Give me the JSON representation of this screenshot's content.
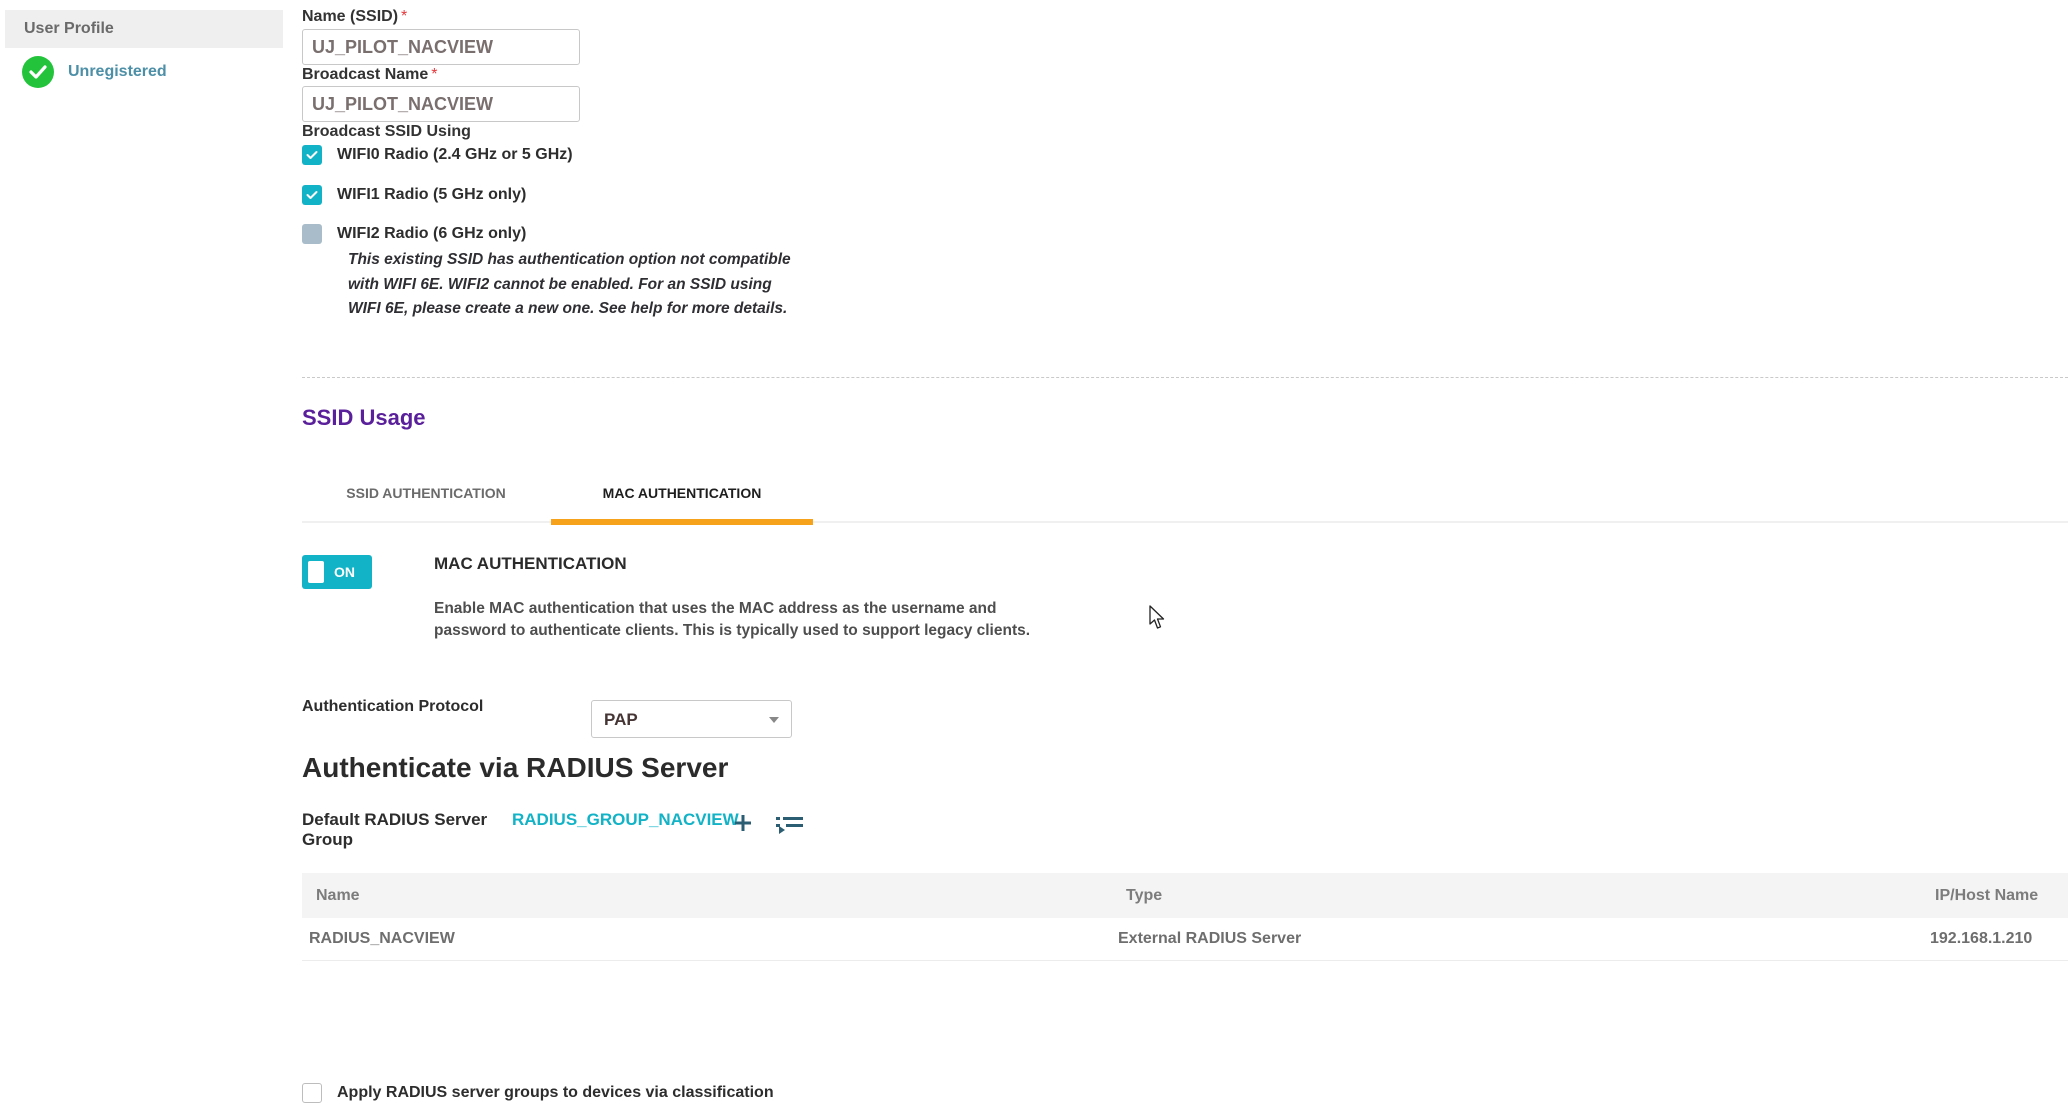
{
  "sidebar": {
    "header": "User Profile",
    "status": {
      "label": "Unregistered",
      "icon": "check-circle-icon",
      "color": "#23c43c"
    }
  },
  "form": {
    "ssid_name": {
      "label": "Name (SSID)",
      "required_mark": "*",
      "value": "UJ_PILOT_NACVIEW"
    },
    "broadcast_name": {
      "label": "Broadcast Name",
      "required_mark": "*",
      "value": "UJ_PILOT_NACVIEW"
    },
    "broadcast_using": {
      "label": "Broadcast SSID Using",
      "options": [
        {
          "label": "WIFI0 Radio (2.4 GHz or 5 GHz)",
          "checked": true,
          "disabled": false
        },
        {
          "label": "WIFI1 Radio (5 GHz only)",
          "checked": true,
          "disabled": false
        },
        {
          "label": "WIFI2 Radio (6 GHz only)",
          "checked": false,
          "disabled": true
        }
      ],
      "note": "This existing SSID has authentication option not compatible with WIFI 6E. WIFI2 cannot be enabled. For an SSID using WIFI 6E, please create a new one. See help for more details."
    }
  },
  "ssid_usage": {
    "title": "SSID Usage",
    "tabs": [
      {
        "label": "SSID AUTHENTICATION",
        "active": false
      },
      {
        "label": "MAC AUTHENTICATION",
        "active": true
      }
    ],
    "mac_auth": {
      "toggle_label": "ON",
      "enabled": true,
      "heading": "MAC AUTHENTICATION",
      "description": "Enable MAC authentication that uses the MAC address as the username and password to authenticate clients. This is typically used to support legacy clients."
    },
    "auth_protocol": {
      "label": "Authentication Protocol",
      "selected": "PAP"
    }
  },
  "radius": {
    "title": "Authenticate via RADIUS Server",
    "default_group_label": "Default RADIUS Server Group",
    "default_group_value": "RADIUS_GROUP_NACVIEW",
    "add_icon": "plus-icon",
    "select_icon": "list-select-icon",
    "table": {
      "columns": [
        "Name",
        "Type",
        "IP/Host Name"
      ],
      "rows": [
        [
          "RADIUS_NACVIEW",
          "External RADIUS Server",
          "192.168.1.210"
        ]
      ]
    },
    "apply_classification": {
      "label": "Apply RADIUS server groups to devices via classification",
      "checked": false
    }
  },
  "colors": {
    "accent": "#12b3c6",
    "tab_underline": "#f7a21b",
    "section_title": "#5a1f9a"
  }
}
